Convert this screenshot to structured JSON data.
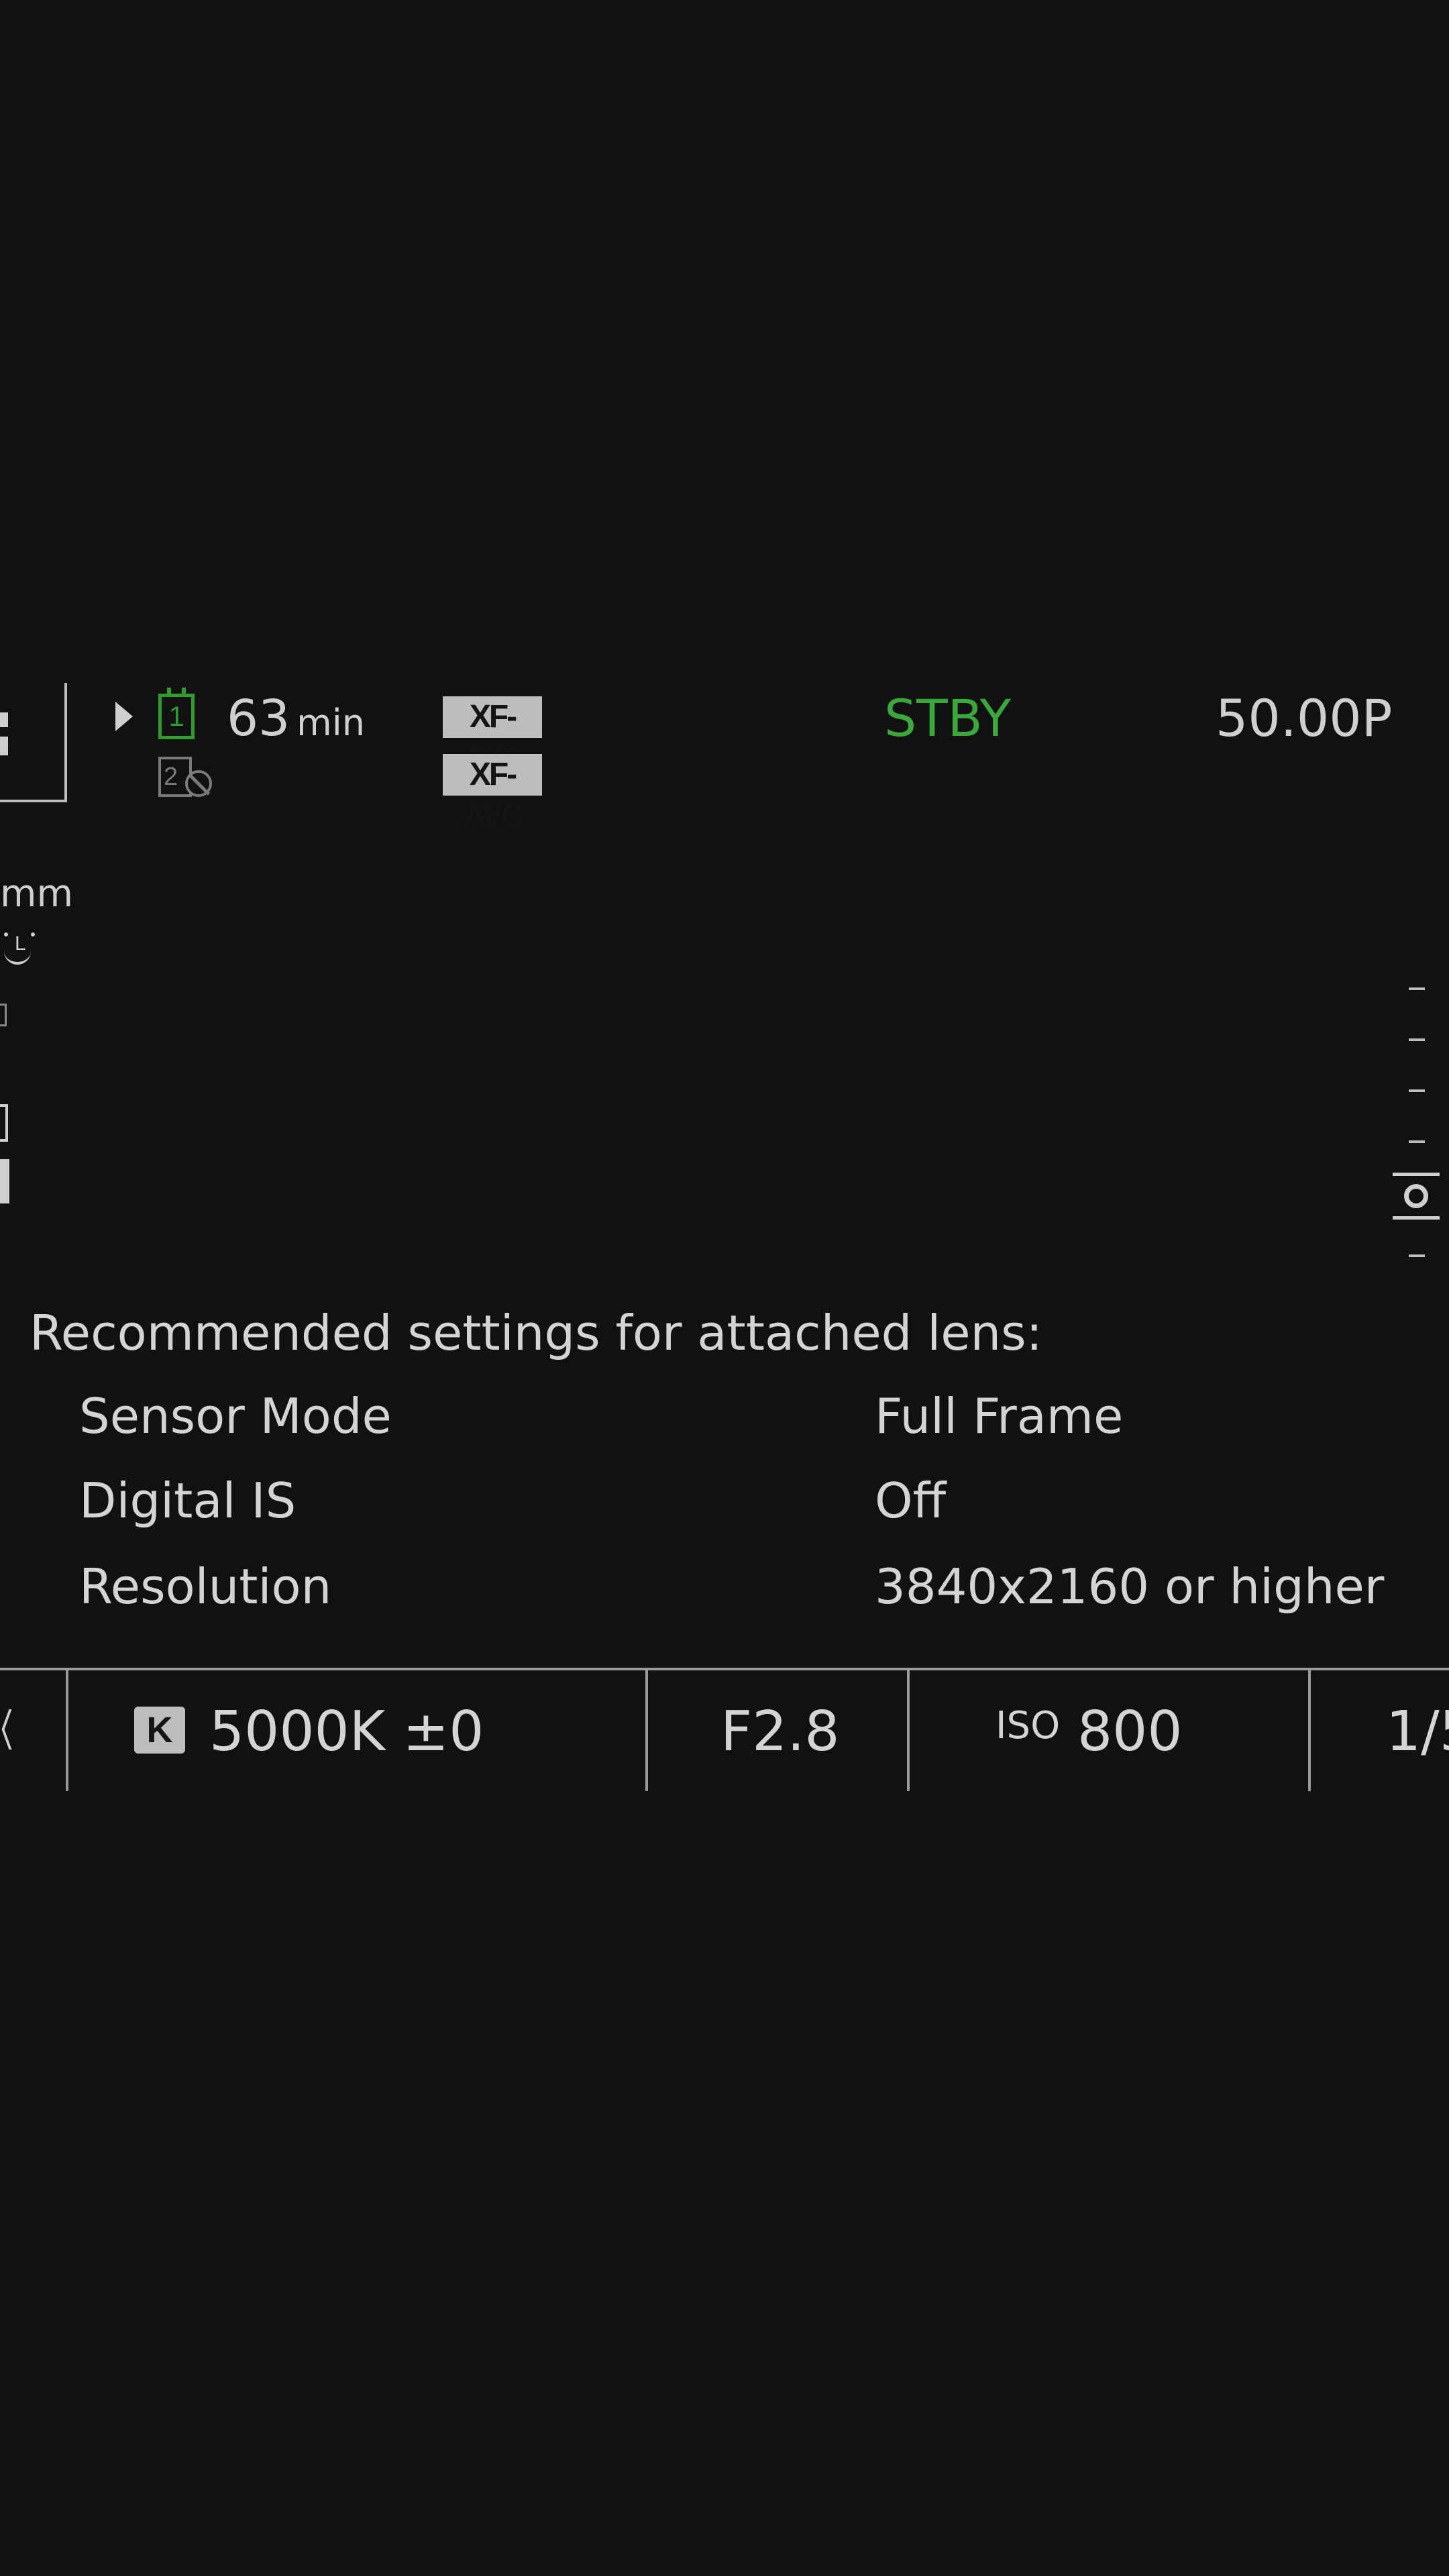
{
  "status": {
    "media_slot_1": "1",
    "media_slot_2": "2",
    "remaining_time_value": "63",
    "remaining_time_unit": "min",
    "codec_slot_1": "XF-AVC",
    "codec_slot_2": "XF-AVC",
    "record_state": "STBY",
    "frame_rate": "50.00P",
    "colors": {
      "standby_green": "#3aa83a",
      "slot_active_green": "#2e9c2e",
      "slot_inactive_gray": "#7a7a7a"
    }
  },
  "left_edge": {
    "focal_unit": "mm",
    "icons": [
      "face-detection-icon",
      "aspect-marker-icon",
      "assign-icon",
      "assign-icon-2"
    ]
  },
  "right_edge": {
    "icons": [
      "focus-guide-icon"
    ]
  },
  "message": {
    "heading": "Recommended settings for attached lens:",
    "rows": [
      {
        "label": "Sensor Mode",
        "value": "Full Frame"
      },
      {
        "label": "Digital IS",
        "value": "Off"
      },
      {
        "label": "Resolution",
        "value": "3840x2160 or higher"
      }
    ]
  },
  "exposure_bar": {
    "wb_icon_letter": "K",
    "white_balance": "5000K ±0",
    "iris": "F2.8",
    "iso_label": "ISO",
    "iso_value": "800",
    "shutter_partial": "1/5"
  }
}
